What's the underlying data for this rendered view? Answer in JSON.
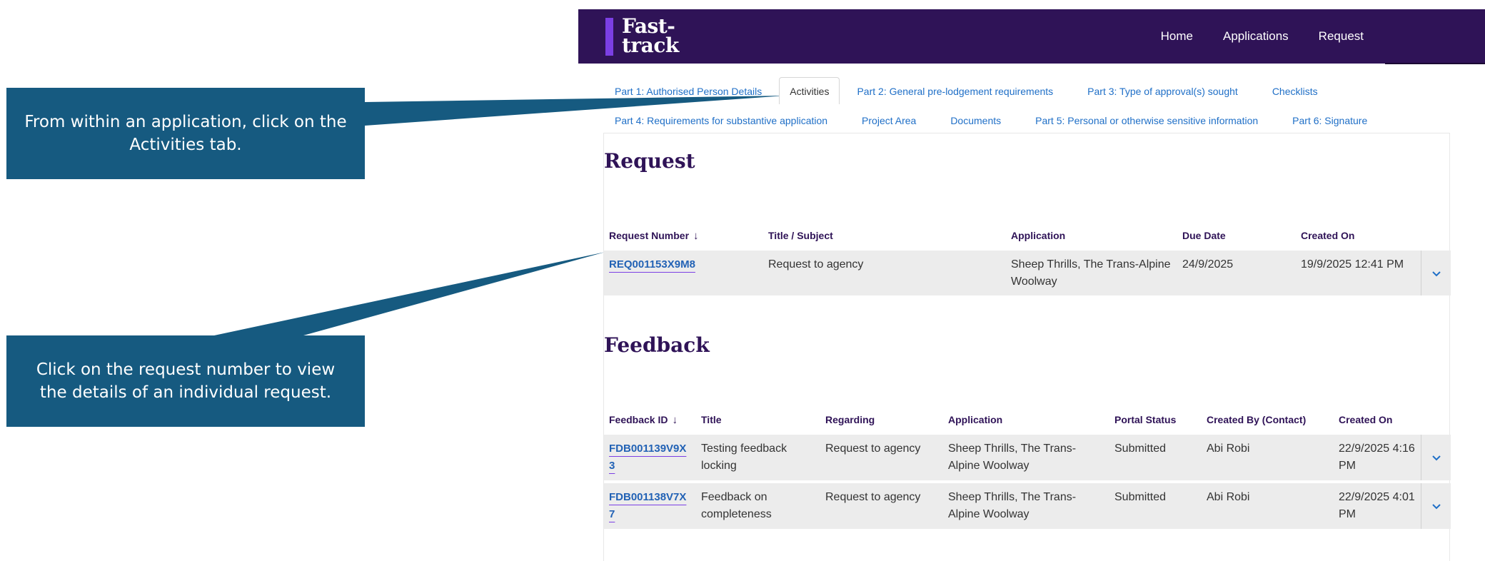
{
  "callouts": [
    {
      "text": "From within an application, click on the Activities tab."
    },
    {
      "text": "Click on the request number to view the details of an individual request."
    }
  ],
  "header": {
    "logo_line1": "Fast-",
    "logo_line2": "track",
    "nav": [
      "Home",
      "Applications",
      "Request"
    ]
  },
  "tabs": {
    "row1": [
      "Part 1: Authorised Person Details",
      "Activities",
      "Part 2: General pre-lodgement requirements",
      "Part 3: Type of approval(s) sought",
      "Checklists"
    ],
    "row2": [
      "Part 4: Requirements for substantive application",
      "Project Area",
      "Documents",
      "Part 5: Personal or otherwise sensitive information",
      "Part 6: Signature"
    ],
    "active": "Activities"
  },
  "request": {
    "title": "Request",
    "columns": [
      "Request Number",
      "Title / Subject",
      "Application",
      "Due Date",
      "Created On"
    ],
    "sort_glyph": "↓",
    "rows": [
      {
        "number": "REQ001153X9M8",
        "subject": "Request to agency",
        "application": "Sheep Thrills, The Trans-Alpine Woolway",
        "due": "24/9/2025",
        "created": "19/9/2025 12:41 PM"
      }
    ]
  },
  "feedback": {
    "title": "Feedback",
    "columns": [
      "Feedback ID",
      "Title",
      "Regarding",
      "Application",
      "Portal Status",
      "Created By (Contact)",
      "Created On"
    ],
    "sort_glyph": "↓",
    "rows": [
      {
        "id": "FDB001139V9X3",
        "title": "Testing feedback locking",
        "regarding": "Request to agency",
        "application": "Sheep Thrills, The Trans-Alpine Woolway",
        "status": "Submitted",
        "created_by": "Abi Robi",
        "created": "22/9/2025 4:16 PM"
      },
      {
        "id": "FDB001138V7X7",
        "title": "Feedback on completeness",
        "regarding": "Request to agency",
        "application": "Sheep Thrills, The Trans-Alpine Woolway",
        "status": "Submitted",
        "created_by": "Abi Robi",
        "created": "22/9/2025 4:01 PM"
      }
    ]
  },
  "colors": {
    "header": "#2f1357",
    "accent": "#7b3fe4",
    "callout": "#165a80",
    "link": "#2262b5"
  },
  "icons": {
    "expand": "chevron-down-icon",
    "sort": "arrow-down-icon"
  }
}
